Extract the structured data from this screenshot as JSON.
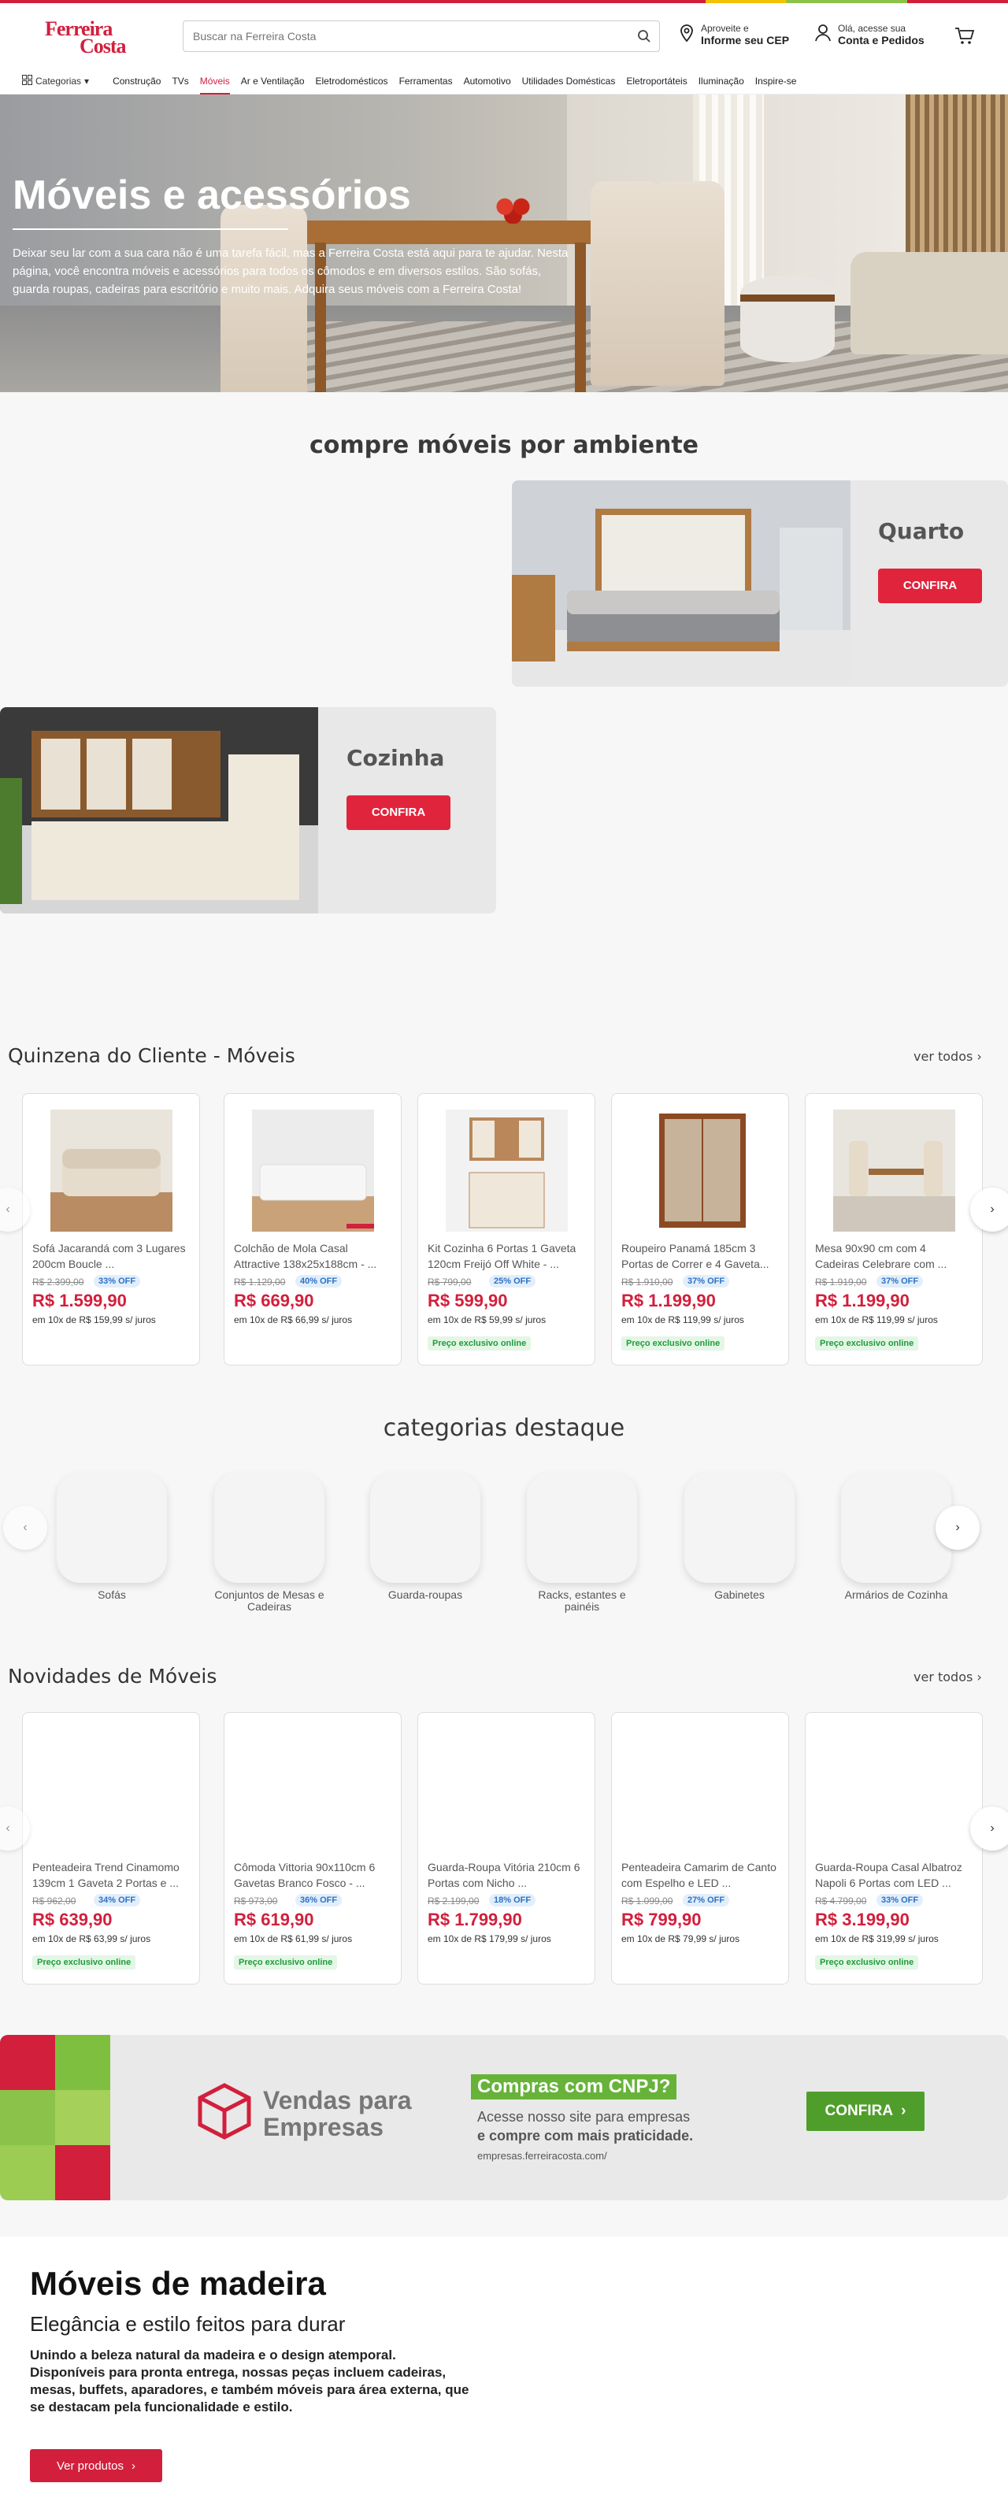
{
  "header": {
    "logo_line1": "Ferreira",
    "logo_line2": "Costa",
    "search_placeholder": "Buscar na Ferreira Costa",
    "cep_line1": "Aproveite e",
    "cep_line2": "Informe seu CEP",
    "account_line1": "Olá, acesse sua",
    "account_line2": "Conta e Pedidos"
  },
  "nav": {
    "categories_label": "Categorias",
    "items": [
      "Construção",
      "TVs",
      "Móveis",
      "Ar e Ventilação",
      "Eletrodomésticos",
      "Ferramentas",
      "Automotivo",
      "Utilidades Domésticas",
      "Eletroportáteis",
      "Iluminação",
      "Inspire-se"
    ]
  },
  "hero": {
    "title": "Móveis e acessórios",
    "text": "Deixar seu lar com a sua cara não é uma tarefa fácil, mas a Ferreira Costa está aqui para te ajudar. Nesta página, você encontra móveis e acessórios para todos os cômodos e em diversos estilos. São sofás, guarda roupas, cadeiras para escritório e muito mais. Adquira seus móveis com a Ferreira Costa!"
  },
  "ambientes": {
    "title": "compre móveis por ambiente",
    "items": [
      {
        "name": "Quarto",
        "button": "CONFIRA"
      },
      {
        "name": "Cozinha",
        "button": "CONFIRA"
      }
    ]
  },
  "quinzena": {
    "title": "Quinzena do Cliente - Móveis",
    "see_all": "ver todos",
    "products": [
      {
        "name": "Sofá Jacarandá com 3 Lugares 200cm Boucle ...",
        "old": "R$ 2.399,00",
        "off": "33% OFF",
        "price": "R$ 1.599,90",
        "installment": "em 10x de R$ 159,99 s/ juros",
        "exclusive": ""
      },
      {
        "name": "Colchão de Mola Casal Attractive 138x25x188cm - ...",
        "old": "R$ 1.129,00",
        "off": "40% OFF",
        "price": "R$ 669,90",
        "installment": "em 10x de R$ 66,99 s/ juros",
        "exclusive": ""
      },
      {
        "name": "Kit Cozinha 6 Portas 1 Gaveta 120cm Freijó Off White - ...",
        "old": "R$ 799,00",
        "off": "25% OFF",
        "price": "R$ 599,90",
        "installment": "em 10x de R$ 59,99 s/ juros",
        "exclusive": "Preço exclusivo online"
      },
      {
        "name": "Roupeiro Panamá 185cm 3 Portas de Correr e 4 Gaveta...",
        "old": "R$ 1.910,00",
        "off": "37% OFF",
        "price": "R$ 1.199,90",
        "installment": "em 10x de R$ 119,99 s/ juros",
        "exclusive": "Preço exclusivo online"
      },
      {
        "name": "Mesa 90x90 cm com 4 Cadeiras Celebrare com ...",
        "old": "R$ 1.919,00",
        "off": "37% OFF",
        "price": "R$ 1.199,90",
        "installment": "em 10x de R$ 119,99 s/ juros",
        "exclusive": "Preço exclusivo online"
      }
    ]
  },
  "categorias": {
    "title": "categorias destaque",
    "items": [
      "Sofás",
      "Conjuntos de Mesas e Cadeiras",
      "Guarda-roupas",
      "Racks, estantes e painéis",
      "Gabinetes",
      "Armários de Cozinha"
    ]
  },
  "novidades": {
    "title": "Novidades de Móveis",
    "see_all": "ver todos",
    "products": [
      {
        "name": "Penteadeira Trend Cinamomo 139cm 1 Gaveta 2 Portas e ...",
        "old": "R$ 962,00",
        "off": "34% OFF",
        "price": "R$ 639,90",
        "installment": "em 10x de R$ 63,99 s/ juros",
        "exclusive": "Preço exclusivo online"
      },
      {
        "name": "Cômoda Vittoria 90x110cm 6 Gavetas Branco Fosco - ...",
        "old": "R$ 973,00",
        "off": "36% OFF",
        "price": "R$ 619,90",
        "installment": "em 10x de R$ 61,99 s/ juros",
        "exclusive": "Preço exclusivo online"
      },
      {
        "name": "Guarda-Roupa Vitória 210cm 6 Portas com Nicho ...",
        "old": "R$ 2.199,00",
        "off": "18% OFF",
        "price": "R$ 1.799,90",
        "installment": "em 10x de R$ 179,99 s/ juros",
        "exclusive": ""
      },
      {
        "name": "Penteadeira Camarim de Canto com Espelho e LED ...",
        "old": "R$ 1.099,00",
        "off": "27% OFF",
        "price": "R$ 799,90",
        "installment": "em 10x de R$ 79,99 s/ juros",
        "exclusive": ""
      },
      {
        "name": "Guarda-Roupa Casal Albatroz Napoli 6 Portas com LED ...",
        "old": "R$ 4.799,00",
        "off": "33% OFF",
        "price": "R$ 3.199,90",
        "installment": "em 10x de R$ 319,99 s/ juros",
        "exclusive": "Preço exclusivo online"
      }
    ]
  },
  "banner": {
    "vendas": "Vendas para Empresas",
    "cnpj_title": "Compras com CNPJ?",
    "cnpj_line1": "Acesse nosso site para empresas",
    "cnpj_line2": "e compre com mais praticidade.",
    "url": "empresas.ferreiracosta.com/",
    "button": "CONFIRA"
  },
  "madeira": {
    "title": "Móveis de madeira",
    "subtitle": "Elegância e estilo feitos para durar",
    "text": "Unindo a beleza natural da madeira e o design atemporal. Disponíveis para pronta entrega, nossas peças incluem cadeiras, mesas, buffets, aparadores, e também móveis para área externa, que se destacam pela funcionalidade e estilo.",
    "button": "Ver produtos"
  },
  "colors": {
    "brand_red": "#d21f3c",
    "green": "#67b33a",
    "offer_blue": "#2a72c6"
  }
}
